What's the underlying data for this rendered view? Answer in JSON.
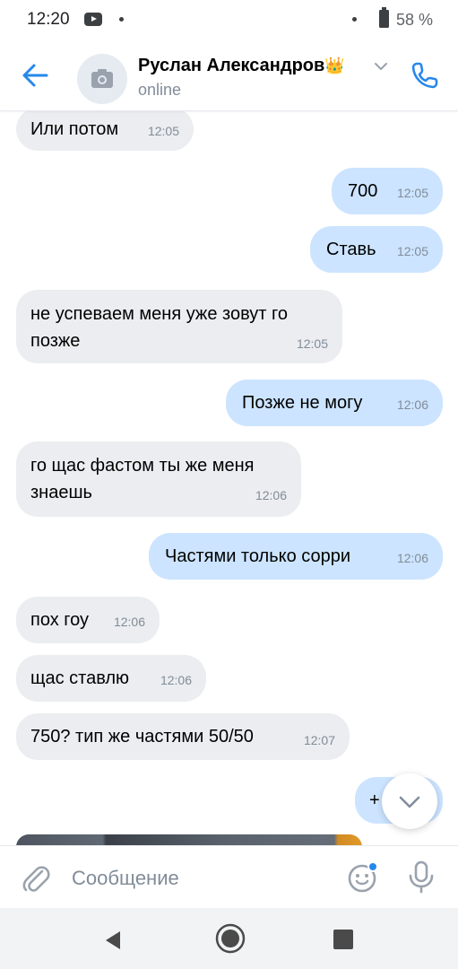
{
  "status_bar": {
    "time": "12:20",
    "battery": "58 %"
  },
  "header": {
    "name": "Руслан Александров",
    "name_emoji": "👑",
    "status": "online"
  },
  "messages": [
    {
      "dir": "in",
      "text": "Или потом",
      "time": "12:05"
    },
    {
      "dir": "out",
      "text": "700",
      "time": "12:05"
    },
    {
      "dir": "out",
      "text": "Ставь",
      "time": "12:05"
    },
    {
      "dir": "in",
      "text_lines": [
        "не успеваем меня уже зовут го",
        "позже"
      ],
      "time": "12:05"
    },
    {
      "dir": "out",
      "text": "Позже не могу",
      "time": "12:06"
    },
    {
      "dir": "in",
      "text_lines": [
        "го щас фастом ты же меня",
        "знаешь"
      ],
      "time": "12:06"
    },
    {
      "dir": "out",
      "text": "Частями только сорри",
      "time": "12:06"
    },
    {
      "dir": "in",
      "text": "пох гоу",
      "time": "12:06"
    },
    {
      "dir": "in",
      "text": "щас ставлю",
      "time": "12:06"
    },
    {
      "dir": "in",
      "text": "750? тип же частями 50/50",
      "time": "12:07"
    },
    {
      "dir": "out",
      "text": "+",
      "time": ""
    }
  ],
  "composer": {
    "placeholder": "Сообщение"
  },
  "colors": {
    "accent": "#2688eb",
    "incoming_bubble": "#ebedf0",
    "outgoing_bubble": "#cce4ff",
    "secondary_text": "#818c99",
    "unread_dot": "#2688eb"
  },
  "icons": {
    "back": "arrow-left-icon",
    "avatar": "camera-icon",
    "name_dropdown": "chevron-down-icon",
    "call": "phone-icon",
    "scroll_down": "chevron-down-icon",
    "attach": "paperclip-icon",
    "emoji": "smile-icon",
    "mic": "microphone-icon"
  }
}
